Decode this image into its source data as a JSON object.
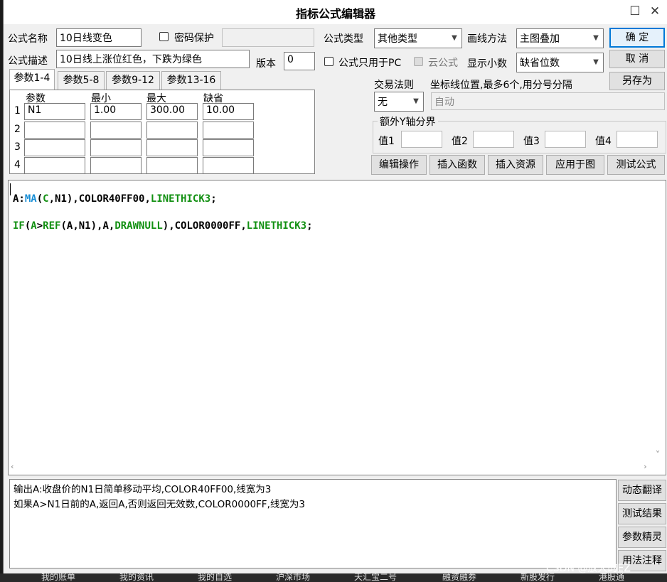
{
  "window": {
    "title": "指标公式编辑器",
    "minimize": "☐",
    "close": "✕"
  },
  "header": {
    "formula_name_label": "公式名称",
    "formula_name_value": "10日线变色",
    "password_label": "密码保护",
    "formula_type_label": "公式类型",
    "formula_type_value": "其他类型",
    "draw_method_label": "画线方法",
    "draw_method_value": "主图叠加",
    "formula_desc_label": "公式描述",
    "formula_desc_value": "10日线上涨位红色，下跌为绿色",
    "version_label": "版本",
    "version_value": "0",
    "pc_only_label": "公式只用于PC",
    "cloud_label": "云公式",
    "decimals_label": "显示小数",
    "decimals_value": "缺省位数"
  },
  "buttons": {
    "ok": "确 定",
    "cancel": "取 消",
    "save_as": "另存为"
  },
  "tabs": [
    "参数1-4",
    "参数5-8",
    "参数9-12",
    "参数13-16"
  ],
  "params": {
    "headers": [
      "参数",
      "最小",
      "最大",
      "缺省"
    ],
    "rows": [
      {
        "num": "1",
        "name": "N1",
        "min": "1.00",
        "max": "300.00",
        "def": "10.00"
      },
      {
        "num": "2",
        "name": "",
        "min": "",
        "max": "",
        "def": ""
      },
      {
        "num": "3",
        "name": "",
        "min": "",
        "max": "",
        "def": ""
      },
      {
        "num": "4",
        "name": "",
        "min": "",
        "max": "",
        "def": ""
      }
    ]
  },
  "trade": {
    "label": "交易法则",
    "value": "无"
  },
  "coords": {
    "label": "坐标线位置,最多6个,用分号分隔",
    "value": "自动"
  },
  "yaxis": {
    "title": "额外Y轴分界",
    "v1": "值1",
    "v2": "值2",
    "v3": "值3",
    "v4": "值4"
  },
  "actions": [
    "编辑操作",
    "插入函数",
    "插入资源",
    "应用于图",
    "测试公式"
  ],
  "code": {
    "line1": [
      {
        "t": "A:",
        "c": "var"
      },
      {
        "t": "MA",
        "c": "fn"
      },
      {
        "t": "(",
        "c": "text"
      },
      {
        "t": "C",
        "c": "kw"
      },
      {
        "t": ",N1),COLOR40FF00,",
        "c": "text"
      },
      {
        "t": "LINETHICK3",
        "c": "kw"
      },
      {
        "t": ";",
        "c": "text"
      }
    ],
    "line2": [
      {
        "t": "IF",
        "c": "kw"
      },
      {
        "t": "(",
        "c": "text"
      },
      {
        "t": "A",
        "c": "kw"
      },
      {
        "t": ">",
        "c": "text"
      },
      {
        "t": "REF",
        "c": "kw"
      },
      {
        "t": "(A,N1),A,",
        "c": "text"
      },
      {
        "t": "DRAWNULL",
        "c": "kw"
      },
      {
        "t": "),COLOR0000FF,",
        "c": "text"
      },
      {
        "t": "LINETHICK3",
        "c": "kw"
      },
      {
        "t": ";",
        "c": "text"
      }
    ]
  },
  "description": {
    "line1": "输出A:收盘价的N1日简单移动平均,COLOR40FF00,线宽为3",
    "line2": "如果A>N1日前的A,返回A,否则返回无效数,COLOR0000FF,线宽为3"
  },
  "side_buttons": [
    "动态翻译",
    "测试结果",
    "参数精灵",
    "用法注释"
  ],
  "taskbar": {
    "items": [
      "我的账单",
      "我的资讯",
      "我的自选",
      "沪深市场",
      "天汇宝二号",
      "融资融券",
      "新股发行",
      "港股通"
    ],
    "watermark": "CSDN @放大的EZ"
  }
}
